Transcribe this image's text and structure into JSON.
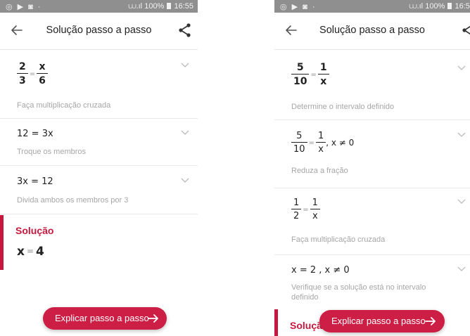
{
  "status_bar": {
    "battery": "100%",
    "time": "16:55"
  },
  "toolbar": {
    "title": "Solução passo a passo"
  },
  "left_screen": {
    "steps": [
      {
        "math": {
          "a_num": "2",
          "a_den": "3",
          "eq": "=",
          "b_num": "x",
          "b_den": "6"
        },
        "caption": "Faça multiplicação cruzada"
      },
      {
        "math": {
          "text": "12 = 3x"
        },
        "caption": "Troque os membros"
      },
      {
        "math": {
          "text": "3x = 12"
        },
        "caption": "Divida ambos os membros por 3"
      }
    ],
    "solution": {
      "title": "Solução",
      "var": "x",
      "eq": "=",
      "value": "4"
    },
    "explain_button": "Explicar passo a passo"
  },
  "right_screen": {
    "steps": [
      {
        "math": {
          "a_num": "5",
          "a_den": "10",
          "eq": "=",
          "b_num": "1",
          "b_den": "x"
        },
        "caption": "Determine o intervalo definido"
      },
      {
        "math": {
          "a_num": "5",
          "a_den": "10",
          "eq": "=",
          "b_num": "1",
          "b_den": "x",
          "cond": ", x ≠ 0"
        },
        "caption": "Reduza a fração"
      },
      {
        "math": {
          "a_num": "1",
          "a_den": "2",
          "eq": "=",
          "b_num": "1",
          "b_den": "x"
        },
        "caption": "Faça multiplicação cruzada"
      },
      {
        "math": {
          "text": "x = 2 , x ≠ 0"
        },
        "caption": "Verifique se a solução está no intervalo definido"
      }
    ],
    "solution": {
      "title": "Solução"
    },
    "explain_button": "Explicar passo a passo"
  },
  "colors": {
    "accent": "#c8173c",
    "button": "#cd1f45",
    "status_bar": "#8f8f8f"
  }
}
